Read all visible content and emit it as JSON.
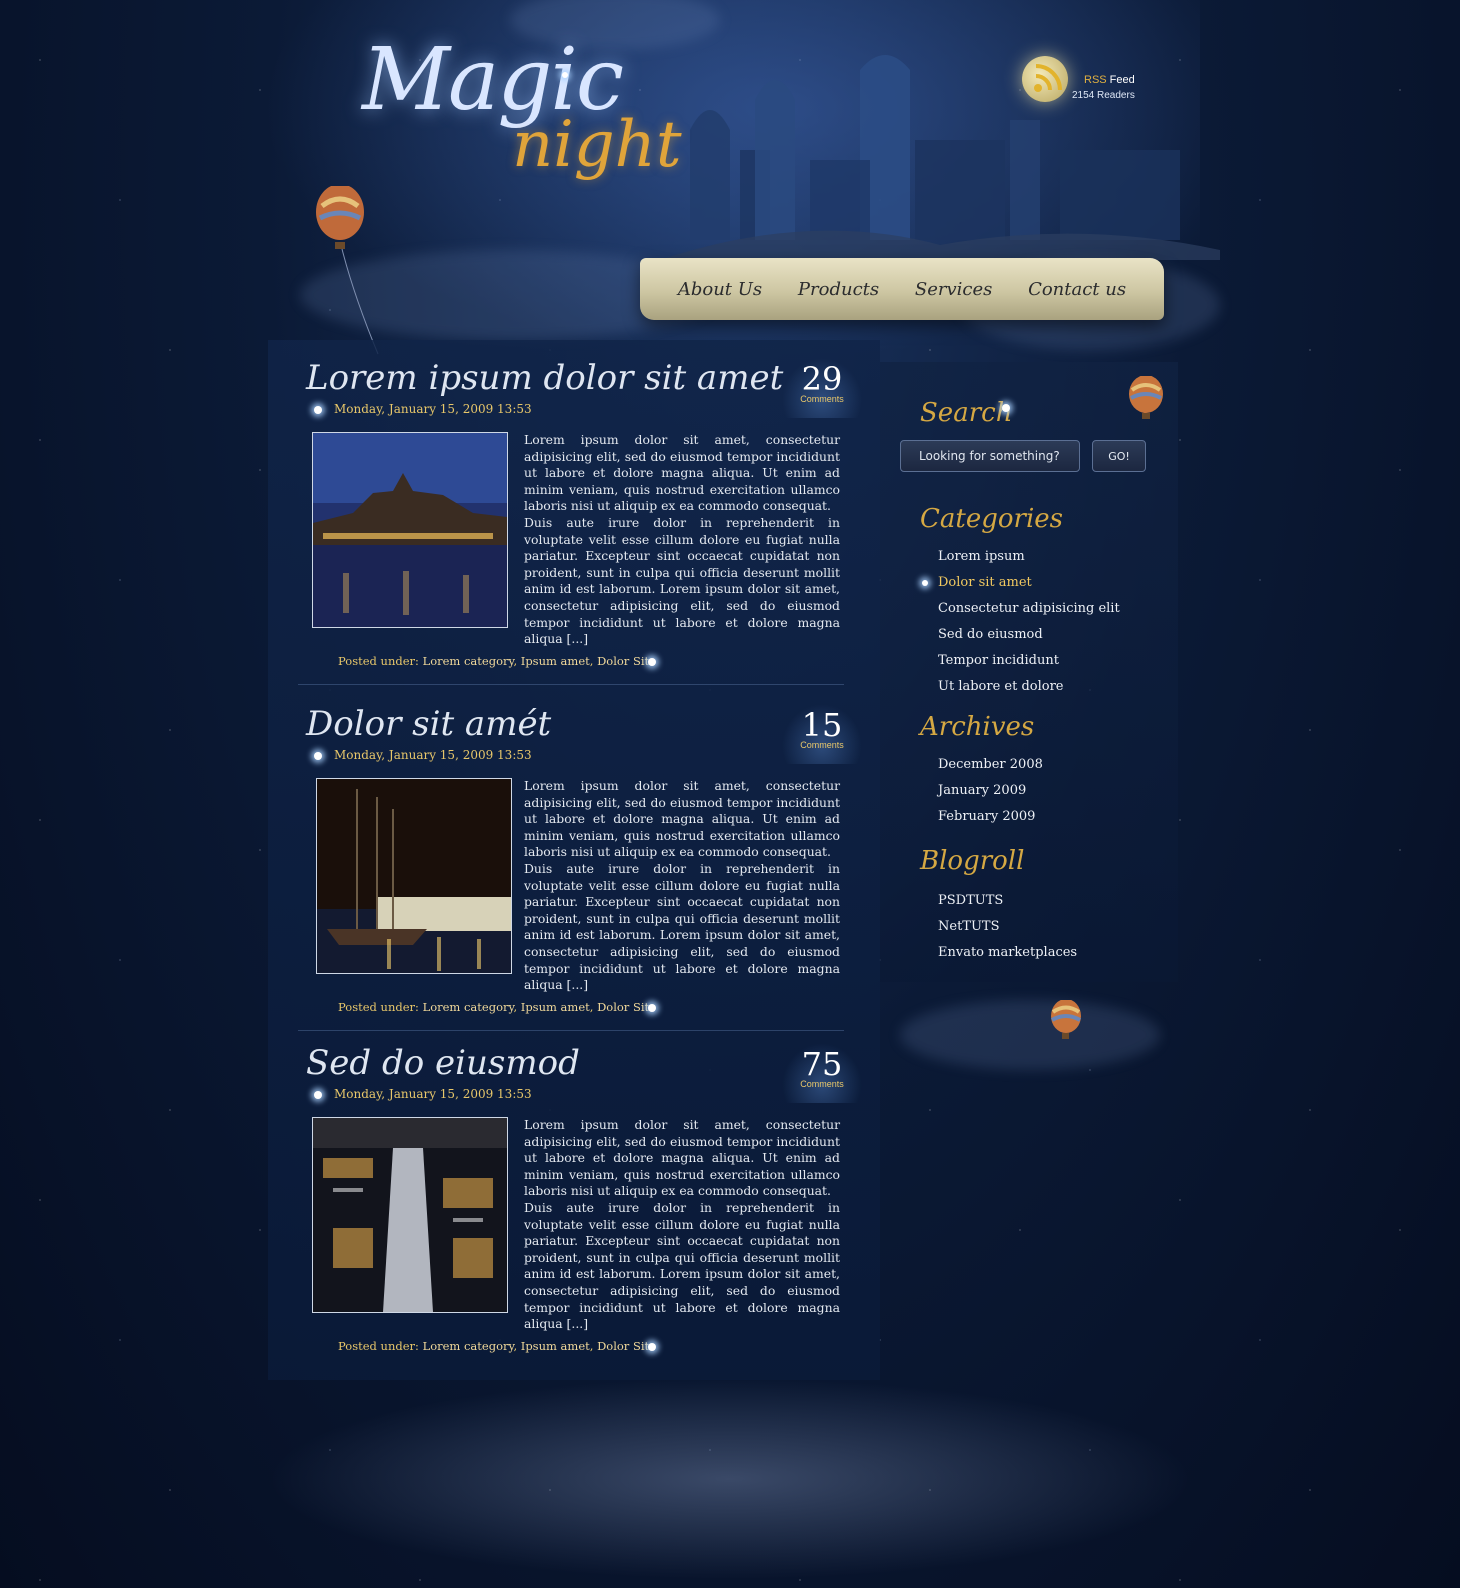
{
  "logo": {
    "word1": "Magic",
    "word2": "night"
  },
  "rss": {
    "label_accent": "RSS",
    "label_rest": " Feed",
    "readers": "2154 Readers",
    "icon": "rss-icon"
  },
  "nav": {
    "items": [
      "About Us",
      "Products",
      "Services",
      "Contact us"
    ]
  },
  "posts": [
    {
      "title": "Lorem ipsum dolor sit amet",
      "date": "Monday, January 15, 2009 13:53",
      "comments": "29",
      "comments_label": "Comments",
      "p1": "Lorem ipsum dolor sit amet, consectetur adipisicing elit, sed do eiusmod tempor incididunt ut labore et dolore magna aliqua. Ut enim ad minim veniam, quis nostrud exercitation ullamco laboris nisi ut aliquip ex ea commodo consequat.",
      "p2": "Duis aute irure dolor in reprehenderit in voluptate velit esse cillum dolore eu fugiat nulla pariatur. Excepteur sint occaecat cupidatat non proident, sunt in culpa qui officia deserunt mollit anim id est laborum. Lorem ipsum dolor sit amet, consectetur adipisicing elit, sed do eiusmod tempor incididunt ut labore et dolore magna aliqua [...]",
      "posted_label": "Posted under:",
      "tags": [
        "Lorem category",
        "Ipsum amet",
        "Dolor Sit"
      ]
    },
    {
      "title": "Dolor sit amét",
      "date": "Monday, January 15, 2009 13:53",
      "comments": "15",
      "comments_label": "Comments",
      "p1": "Lorem ipsum dolor sit amet, consectetur adipisicing elit, sed do eiusmod tempor incididunt ut labore et dolore magna aliqua. Ut enim ad minim veniam, quis nostrud exercitation ullamco laboris nisi ut aliquip ex ea commodo consequat.",
      "p2": "Duis aute irure dolor in reprehenderit in voluptate velit esse cillum dolore eu fugiat nulla pariatur. Excepteur sint occaecat cupidatat non proident, sunt in culpa qui officia deserunt mollit anim id est laborum. Lorem ipsum dolor sit amet, consectetur adipisicing elit, sed do eiusmod tempor incididunt ut labore et dolore magna aliqua [...]",
      "posted_label": "Posted under:",
      "tags": [
        "Lorem category",
        "Ipsum amet",
        "Dolor Sit"
      ]
    },
    {
      "title": "Sed do eiusmod",
      "date": "Monday, January 15, 2009 13:53",
      "comments": "75",
      "comments_label": "Comments",
      "p1": "Lorem ipsum dolor sit amet, consectetur adipisicing elit, sed do eiusmod tempor incididunt ut labore et dolore magna aliqua. Ut enim ad minim veniam, quis nostrud exercitation ullamco laboris nisi ut aliquip ex ea commodo consequat.",
      "p2": "Duis aute irure dolor in reprehenderit in voluptate velit esse cillum dolore eu fugiat nulla pariatur. Excepteur sint occaecat cupidatat non proident, sunt in culpa qui officia deserunt mollit anim id est laborum. Lorem ipsum dolor sit amet, consectetur adipisicing elit, sed do eiusmod tempor incididunt ut labore et dolore magna aliqua [...]",
      "posted_label": "Posted under:",
      "tags": [
        "Lorem category",
        "Ipsum amet",
        "Dolor Sit"
      ]
    }
  ],
  "sidebar": {
    "search": {
      "title": "Search",
      "placeholder": "Looking for something?",
      "button": "GO!"
    },
    "categories": {
      "title": "Categories",
      "items": [
        "Lorem ipsum",
        "Dolor sit amet",
        "Consectetur adipisicing elit",
        "Sed do eiusmod",
        "Tempor incididunt",
        "Ut labore et dolore"
      ],
      "active_index": 1
    },
    "archives": {
      "title": "Archives",
      "items": [
        "December 2008",
        "January 2009",
        "February 2009"
      ]
    },
    "blogroll": {
      "title": "Blogroll",
      "items": [
        "PSDTUTS",
        "NetTUTS",
        "Envato marketplaces"
      ]
    }
  },
  "colors": {
    "accent_gold": "#e8c76a",
    "title_gold": "#d5a843",
    "background": "#0b1a36",
    "scroll": "#d8d1b0"
  }
}
